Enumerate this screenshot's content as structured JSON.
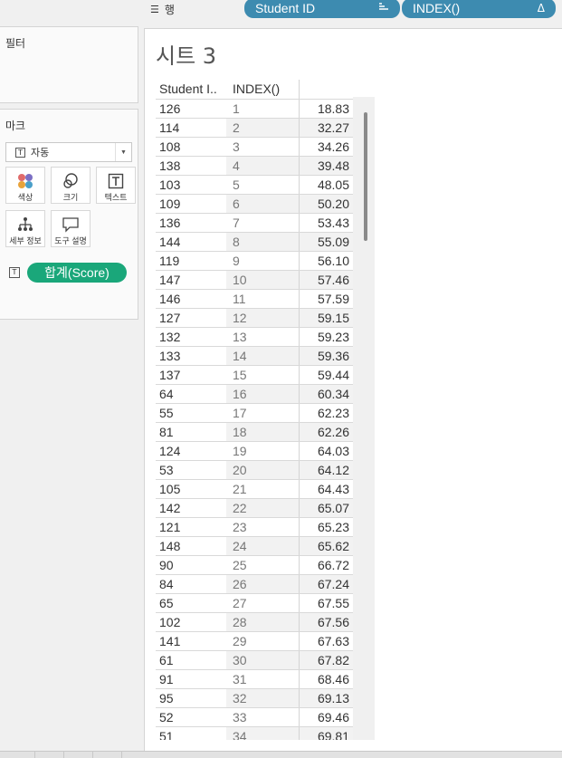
{
  "shelf": {
    "rows_label": "행",
    "pills": [
      {
        "label": "Student ID",
        "icon": "sort-icon"
      },
      {
        "label": "INDEX()",
        "icon": "delta-icon"
      }
    ]
  },
  "filters": {
    "title": "필터"
  },
  "marks": {
    "title": "마크",
    "mark_type": "자동",
    "buttons": [
      {
        "label": "색상",
        "icon": "color-dots-icon"
      },
      {
        "label": "크기",
        "icon": "size-circles-icon"
      },
      {
        "label": "텍스트",
        "icon": "text-icon"
      },
      {
        "label": "세부 정보",
        "icon": "detail-tree-icon"
      },
      {
        "label": "도구 설명",
        "icon": "tooltip-icon"
      }
    ],
    "text_pill": "합계(Score)"
  },
  "sheet": {
    "title": "시트 3",
    "headers": [
      "Student I..",
      "INDEX()",
      ""
    ],
    "rows": [
      [
        "126",
        "1",
        "18.83"
      ],
      [
        "114",
        "2",
        "32.27"
      ],
      [
        "108",
        "3",
        "34.26"
      ],
      [
        "138",
        "4",
        "39.48"
      ],
      [
        "103",
        "5",
        "48.05"
      ],
      [
        "109",
        "6",
        "50.20"
      ],
      [
        "136",
        "7",
        "53.43"
      ],
      [
        "144",
        "8",
        "55.09"
      ],
      [
        "119",
        "9",
        "56.10"
      ],
      [
        "147",
        "10",
        "57.46"
      ],
      [
        "146",
        "11",
        "57.59"
      ],
      [
        "127",
        "12",
        "59.15"
      ],
      [
        "132",
        "13",
        "59.23"
      ],
      [
        "133",
        "14",
        "59.36"
      ],
      [
        "137",
        "15",
        "59.44"
      ],
      [
        "64",
        "16",
        "60.34"
      ],
      [
        "55",
        "17",
        "62.23"
      ],
      [
        "81",
        "18",
        "62.26"
      ],
      [
        "124",
        "19",
        "64.03"
      ],
      [
        "53",
        "20",
        "64.12"
      ],
      [
        "105",
        "21",
        "64.43"
      ],
      [
        "142",
        "22",
        "65.07"
      ],
      [
        "121",
        "23",
        "65.23"
      ],
      [
        "148",
        "24",
        "65.62"
      ],
      [
        "90",
        "25",
        "66.72"
      ],
      [
        "84",
        "26",
        "67.24"
      ],
      [
        "65",
        "27",
        "67.55"
      ],
      [
        "102",
        "28",
        "67.56"
      ],
      [
        "141",
        "29",
        "67.63"
      ],
      [
        "61",
        "30",
        "67.82"
      ],
      [
        "91",
        "31",
        "68.46"
      ],
      [
        "95",
        "32",
        "69.13"
      ],
      [
        "52",
        "33",
        "69.46"
      ],
      [
        "51",
        "34",
        "69.81"
      ]
    ]
  },
  "colors": {
    "dimension_pill": "#3d8bb0",
    "measure_pill": "#1aa77a"
  }
}
